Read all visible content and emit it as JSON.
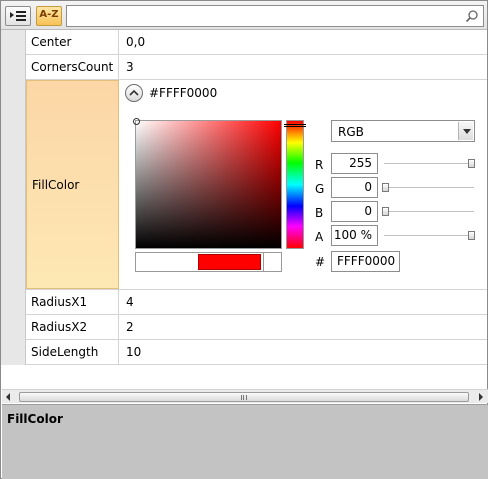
{
  "toolbar": {
    "categorized_icon": "categorized-list-icon",
    "alphabetical_label": "A-Z",
    "search_value": "",
    "search_icon": "magnifier-icon"
  },
  "properties": [
    {
      "name": "Center",
      "value": "0,0"
    },
    {
      "name": "CornersCount",
      "value": "3"
    },
    {
      "name": "FillColor",
      "value": "#FFFF0000"
    },
    {
      "name": "RadiusX1",
      "value": "4"
    },
    {
      "name": "RadiusX2",
      "value": "2"
    },
    {
      "name": "SideLength",
      "value": "10"
    }
  ],
  "color_editor": {
    "header_value": "#FFFF0000",
    "mode": "RGB",
    "channels": [
      {
        "label": "R",
        "value": "255",
        "level": 1.0
      },
      {
        "label": "G",
        "value": "0",
        "level": 0.0
      },
      {
        "label": "B",
        "value": "0",
        "level": 0.0
      },
      {
        "label": "A",
        "value": "100 %",
        "level": 1.0
      }
    ],
    "hex_label": "#",
    "hex_value": "FFFF0000",
    "current_color": "#FF0000"
  },
  "description": {
    "title": "FillColor"
  }
}
